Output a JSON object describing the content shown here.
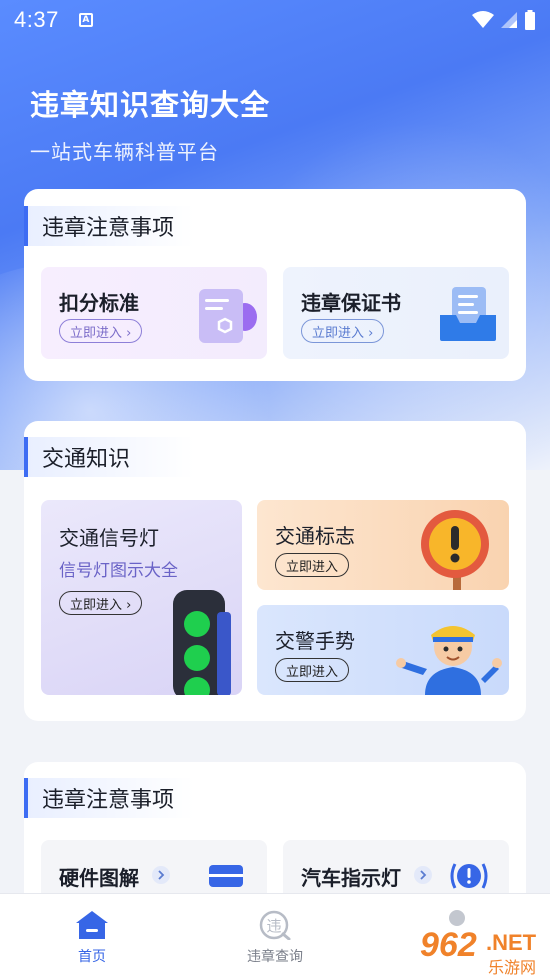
{
  "status_bar": {
    "time": "4:37",
    "notif_glyph": "A"
  },
  "hero": {
    "title": "违章知识查询大全",
    "subtitle": "一站式车辆科普平台"
  },
  "section1": {
    "title": "违章注意事项",
    "tiles": [
      {
        "title": "扣分标准",
        "button": "立即进入 ›",
        "icon": "document-icon"
      },
      {
        "title": "违章保证书",
        "button": "立即进入 ›",
        "icon": "inbox-document-icon"
      }
    ]
  },
  "section2": {
    "title": "交通知识",
    "tiles": [
      {
        "title": "交通信号灯",
        "subtitle": "信号灯图示大全",
        "button": "立即进入 ›",
        "icon": "traffic-light-icon"
      },
      {
        "title": "交通标志",
        "button": "立即进入",
        "icon": "warning-sign-icon"
      },
      {
        "title": "交警手势",
        "button": "立即进入",
        "icon": "police-officer-icon"
      }
    ]
  },
  "section3": {
    "title": "违章注意事项",
    "tiles": [
      {
        "title": "硬件图解",
        "icon": "hardware-icon"
      },
      {
        "title": "汽车指示灯",
        "icon": "indicator-light-icon"
      }
    ]
  },
  "bottom_nav": {
    "items": [
      {
        "label": "首页",
        "icon": "home-icon",
        "active": true
      },
      {
        "label": "违章查询",
        "icon": "violation-query-icon",
        "active": false
      }
    ]
  },
  "watermark": {
    "number": "962",
    "suffix": ".NET",
    "sub": "乐游网"
  },
  "colors": {
    "accent": "#3d6cf3",
    "orange_accent": "#d97a3a"
  }
}
